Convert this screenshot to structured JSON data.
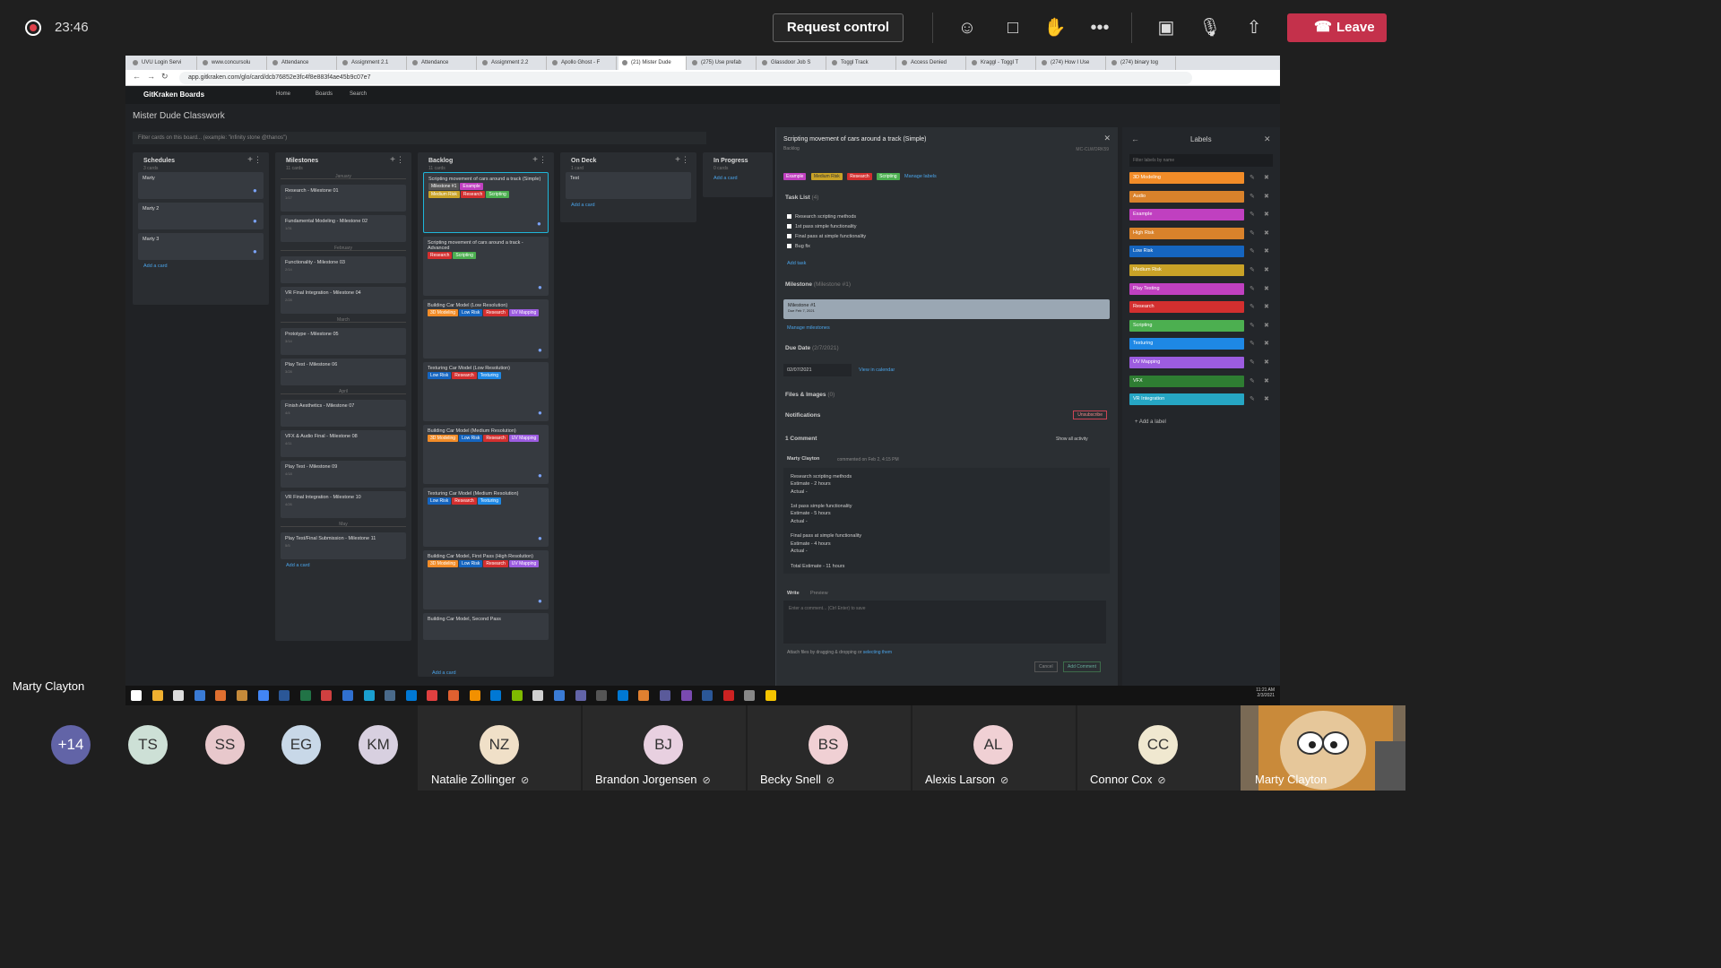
{
  "meeting": {
    "timer": "23:46",
    "request_control": "Request control",
    "leave": "Leave",
    "presenter_name": "Marty Clayton"
  },
  "browser": {
    "tabs": [
      "UVU Login Servi",
      "www.concursolu",
      "Attendance",
      "Assignment 2.1",
      "Attendance",
      "Assignment 2.2",
      "Apollo Ghost - F",
      "(21) Mister Dude",
      "(275) Use prefab",
      "Glassdoor Job S",
      "Toggl Track",
      "Access Denied",
      "Kraggl - Toggl T",
      "(274) How I Use",
      "(274) binary tog"
    ],
    "url": "app.gitkraken.com/glo/card/dcb76852e3fc4f8e883f4ae45b9c07e7"
  },
  "app": {
    "logo": "GitKraken Boards",
    "nav": [
      "Home",
      "Boards",
      "Search"
    ],
    "board_title": "Mister Dude Classwork",
    "filter_placeholder": "Filter cards on this board... (example: \"infinity stone @thanos\")"
  },
  "columns": {
    "schedules": {
      "title": "Schedules",
      "count": "3 cards",
      "cards": [
        "Marty",
        "Marty 2",
        "Marty 3"
      ],
      "add": "Add a card"
    },
    "milestones": {
      "title": "Milestones",
      "count": "11 cards",
      "months": [
        "January",
        "February",
        "March",
        "April",
        "May"
      ],
      "cards": [
        "Research - Milestone 01",
        "Fundamental Modeling - Milestone 02",
        "Functionality - Milestone 03",
        "VR Final Integration - Milestone 04",
        "Prototype - Milestone 05",
        "Play Test - Milestone 06",
        "Finish Aesthetics - Milestone 07",
        "VFX & Audio Final - Milestone 08",
        "Play Test - Milestone 09",
        "VR Final Integration - Milestone 10",
        "Play Test/Final Submission - Milestone 11"
      ],
      "dates": [
        "1/17",
        "1/31",
        "2/14",
        "2/28",
        "3/14",
        "3/28",
        "4/4",
        "4/11",
        "4/18",
        "4/26",
        "5/5"
      ],
      "add": "Add a card"
    },
    "backlog": {
      "title": "Backlog",
      "count": "11 cards",
      "cards": [
        "Scripting movement of cars around a track (Simple)",
        "Scripting movement of cars around a track - Advanced",
        "Building Car Model (Low Resolution)",
        "Texturing Car Model (Low Resolution)",
        "Building Car Model (Medium Resolution)",
        "Texturing Car Model (Medium Resolution)",
        "Building Car Model, First Pass (High Resolution)",
        "Building Car Model, Second Pass"
      ],
      "add": "Add a card"
    },
    "ondeck": {
      "title": "On Deck",
      "count": "1 card",
      "cards": [
        "Test"
      ],
      "add": "Add a card"
    },
    "inprogress": {
      "title": "In Progress",
      "count": "0 cards",
      "add": "Add a card"
    }
  },
  "detail": {
    "title": "Scripting movement of cars around a track (Simple)",
    "column": "Backlog",
    "card_id": "MC-CLWORK59",
    "labels": [
      "Example",
      "Medium Risk",
      "Research",
      "Scripting"
    ],
    "manage_labels": "Manage labels",
    "task_list": "Task List",
    "task_count": "(4)",
    "tasks": [
      "Research scripting methods",
      "1st pass simple functionality",
      "Final pass at simple functionality",
      "Bug fix"
    ],
    "add_task": "Add task",
    "milestone_head": "Milestone",
    "milestone_sub": "(Milestone #1)",
    "milestone_name": "Milestone #1",
    "milestone_due": "Due Feb 7, 2021",
    "manage_milestones": "Manage milestones",
    "due_head": "Due Date",
    "due_sub": "(2/7/2021)",
    "due_value": "02/07/2021",
    "view_calendar": "View in calendar",
    "files": "Files & Images",
    "files_count": "(0)",
    "notifications": "Notifications",
    "unsubscribe": "Unsubscribe",
    "comments_head": "1 Comment",
    "show_activity": "Show all activity",
    "comment_author": "Marty Clayton",
    "comment_time": "commented on Feb 2, 4:15 PM",
    "comment_lines": [
      "Research scripting methods",
      "Estimate - 2 hours",
      "Actual -",
      "",
      "1st pass simple functionality",
      "Estimate - 5 hours",
      "Actual -",
      "",
      "Final pass at simple functionality",
      "Estimate - 4 hours",
      "Actual -",
      "",
      "Total Estimate - 11 hours"
    ],
    "write": "Write",
    "preview": "Preview",
    "comment_placeholder": "Enter a comment... (Ctrl Enter) to save",
    "attach": "Attach files by dragging & dropping or",
    "attach_link": "selecting them",
    "cancel": "Cancel",
    "add_comment": "Add Comment"
  },
  "labels_panel": {
    "title": "Labels",
    "filter_placeholder": "Filter labels by name",
    "items": [
      {
        "name": "3D Modeling",
        "color": "#f28c28"
      },
      {
        "name": "Audio",
        "color": "#d9822b"
      },
      {
        "name": "Example",
        "color": "#c040c0"
      },
      {
        "name": "High Risk",
        "color": "#d9822b"
      },
      {
        "name": "Low Risk",
        "color": "#1565c0"
      },
      {
        "name": "Medium Risk",
        "color": "#c9a227"
      },
      {
        "name": "Play Testing",
        "color": "#c040c0"
      },
      {
        "name": "Research",
        "color": "#d32f2f"
      },
      {
        "name": "Scripting",
        "color": "#4caf50"
      },
      {
        "name": "Texturing",
        "color": "#1e88e5"
      },
      {
        "name": "UV Mapping",
        "color": "#9c5ce0"
      },
      {
        "name": "VFX",
        "color": "#2e7d32"
      },
      {
        "name": "VR Integration",
        "color": "#26a6c4"
      }
    ],
    "add_label": "Add a label"
  },
  "participants": [
    {
      "initials": "+14",
      "color": "#6264a7"
    },
    {
      "initials": "TS",
      "color": "#cde0d6"
    },
    {
      "initials": "SS",
      "color": "#e8c8cc"
    },
    {
      "initials": "EG",
      "color": "#c8d8e8"
    },
    {
      "initials": "KM",
      "color": "#d8d0e0"
    },
    {
      "initials": "NZ",
      "name": "Natalie Zollinger",
      "color": "#f0e0c8"
    },
    {
      "initials": "BJ",
      "name": "Brandon Jorgensen",
      "color": "#e8d0e0"
    },
    {
      "initials": "BS",
      "name": "Becky Snell",
      "color": "#f0d0d4"
    },
    {
      "initials": "AL",
      "name": "Alexis Larson",
      "color": "#f0d0d4"
    },
    {
      "initials": "CC",
      "name": "Connor Cox",
      "color": "#f0e8d0"
    }
  ],
  "self_video_name": "Marty Clayton",
  "clock": {
    "time": "11:21 AM",
    "date": "2/3/2021"
  }
}
